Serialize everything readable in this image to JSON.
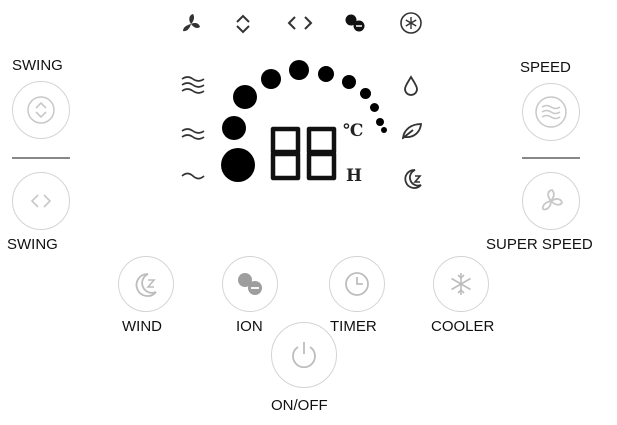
{
  "left_panel": {
    "swing_top_label": "SWING",
    "swing_bottom_label": "SWING"
  },
  "right_panel": {
    "speed_label": "SPEED",
    "super_speed_label": "SUPER SPEED"
  },
  "bottom_buttons": {
    "wind_label": "WIND",
    "ion_label": "ION",
    "timer_label": "TIMER",
    "cooler_label": "COOLER",
    "power_label": "ON/OFF"
  },
  "display": {
    "digits": "88",
    "unit_celsius": "℃",
    "unit_hours": "H",
    "top_icons": [
      "fan-icon",
      "vertical-swing-icon",
      "horizontal-swing-icon",
      "ion-icon",
      "cooler-icon"
    ],
    "left_icons": [
      "wind-high-icon",
      "wind-medium-icon",
      "wind-low-icon"
    ],
    "right_icons": [
      "humidify-icon",
      "natural-wind-icon",
      "sleep-wind-icon"
    ]
  }
}
